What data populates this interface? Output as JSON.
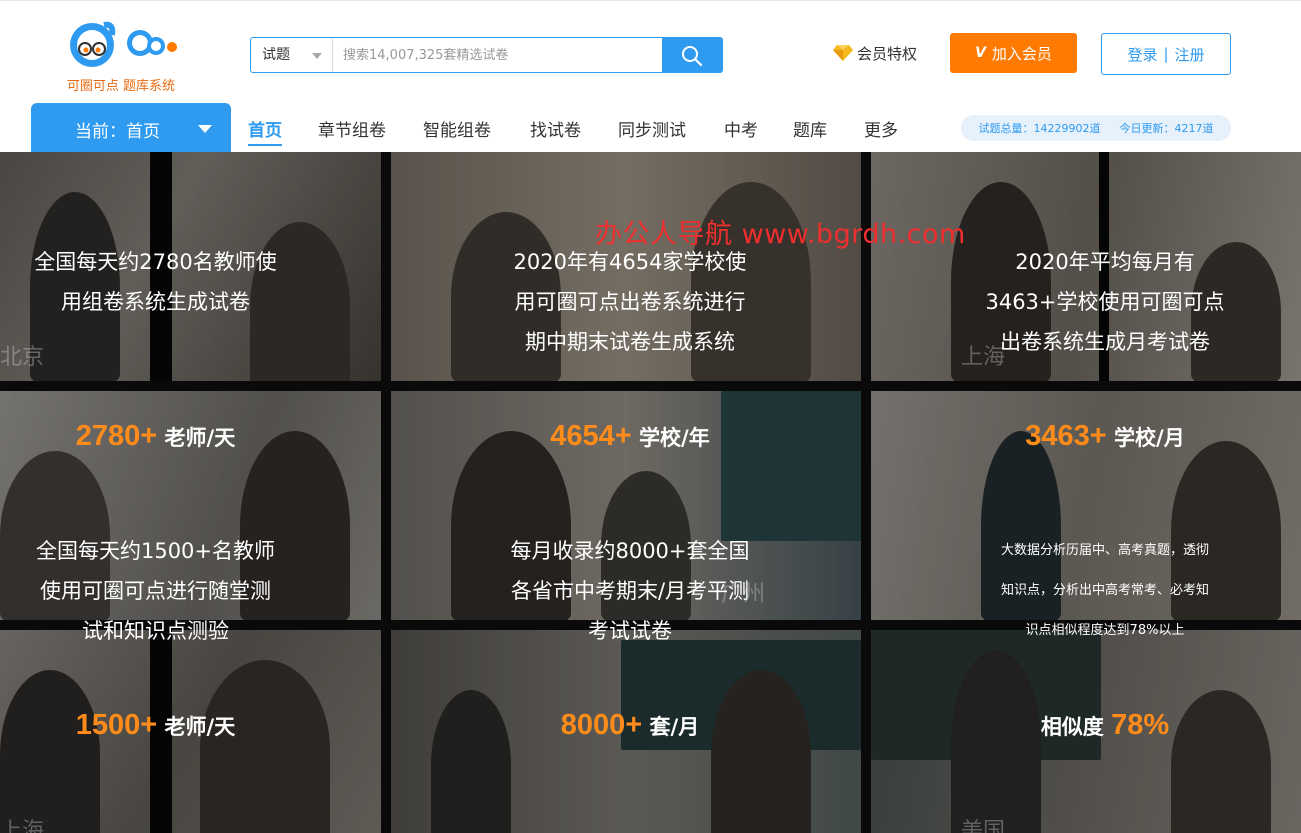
{
  "logo": {
    "subtitle": "可圈可点 题库系统"
  },
  "search": {
    "type_label": "试题",
    "placeholder": "搜索14,007,325套精选试卷"
  },
  "header_links": {
    "vip_privilege": "会员特权",
    "join_vip": "加入会员",
    "join_vip_mark": "V",
    "login": "登录",
    "separator": "|",
    "register": "注册"
  },
  "current": {
    "label": "当前：首页"
  },
  "nav": [
    {
      "label": "首页",
      "active": true
    },
    {
      "label": "章节组卷"
    },
    {
      "label": "智能组卷"
    },
    {
      "label": "找试卷"
    },
    {
      "label": "同步测试"
    },
    {
      "label": "中考"
    },
    {
      "label": "题库"
    },
    {
      "label": "更多"
    }
  ],
  "stats": {
    "total": "试题总量：14229902道",
    "today": "今日更新：4217道"
  },
  "watermark": "办公人导航  www.bgrdh.com",
  "cities": {
    "c1": "北京",
    "c2": "上海",
    "c3": "广州",
    "c4": "上海",
    "c5": "美国"
  },
  "row1": [
    {
      "lines": [
        "全国每天约2780名教师使",
        "用组卷系统生成试卷"
      ]
    },
    {
      "lines": [
        "2020年有4654家学校使",
        "用可圈可点出卷系统进行",
        "期中期末试卷生成系统"
      ]
    },
    {
      "lines": [
        "2020年平均每月有",
        "3463+学校使用可圈可点",
        "出卷系统生成月考试卷"
      ]
    }
  ],
  "metrics1": [
    {
      "num": "2780+",
      "unit": " 老师/天"
    },
    {
      "num": "4654+",
      "unit": " 学校/年"
    },
    {
      "num": "3463+",
      "unit": " 学校/月"
    }
  ],
  "row2": [
    {
      "lines": [
        "全国每天约1500+名教师",
        "使用可圈可点进行随堂测",
        "试和知识点测验"
      ]
    },
    {
      "lines": [
        "每月收录约8000+套全国",
        "各省市中考期末/月考平测",
        "考试试卷"
      ]
    },
    {
      "lines": [
        "大数据分析历届中、高考真题，透彻",
        "知识点，分析出中高考常考、必考知",
        "识点相似程度达到78%以上"
      ]
    }
  ],
  "metrics2": [
    {
      "num": "1500+",
      "unit": " 老师/天"
    },
    {
      "num": "8000+",
      "unit": " 套/月"
    },
    {
      "prefix": "相似度 ",
      "num": "78%"
    }
  ],
  "colors": {
    "accent": "#2e9bf0",
    "orange": "#ff7a00",
    "metric": "#ff8c1a",
    "watermark": "#ef2f2f"
  }
}
